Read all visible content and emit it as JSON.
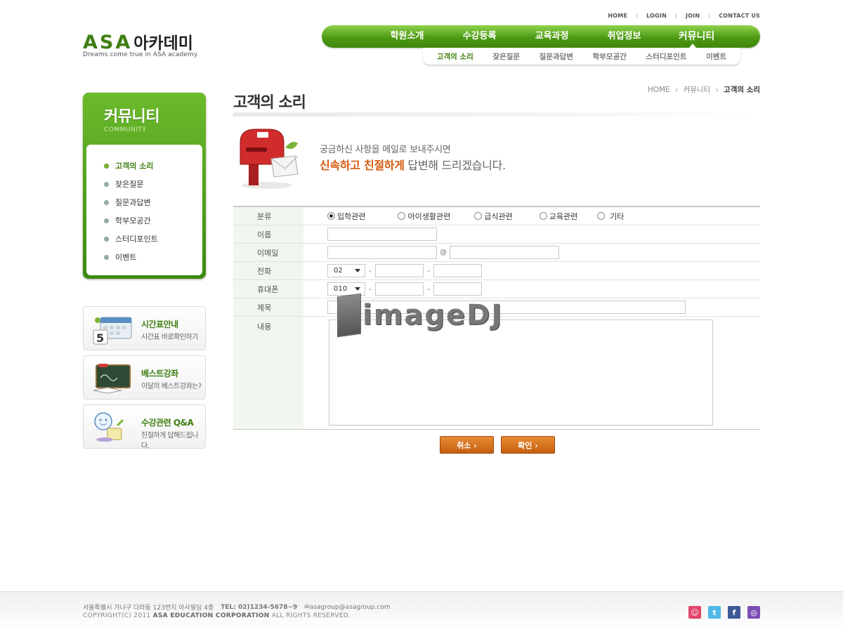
{
  "util_links": [
    "HOME",
    "LOGIN",
    "JOIN",
    "CONTACT US"
  ],
  "logo": {
    "brand": "ASA",
    "kr": "아카데미",
    "tagline": "Dreams come true in ASA academy"
  },
  "gnb": [
    "학원소개",
    "수강등록",
    "교육과정",
    "취업정보",
    "커뮤니티"
  ],
  "lnb": [
    "고객의 소리",
    "잦은질문",
    "질문과답변",
    "학부모공간",
    "스터디포인트",
    "이벤트"
  ],
  "leftmenu": {
    "title": "커뮤니티",
    "eng": "COMMUNITY",
    "items": [
      "고객의 소리",
      "잦은질문",
      "질문과답변",
      "학부모공간",
      "스터디포인트",
      "이벤트"
    ]
  },
  "banners": [
    {
      "title": "시간표안내",
      "desc": "시간표 바로확인하기"
    },
    {
      "title": "베스트강좌",
      "desc": "이달의 베스트강좌는?"
    },
    {
      "title": "수강관련 Q&A",
      "desc": "친절하게 답해드립니다."
    }
  ],
  "content": {
    "title": "고객의 소리",
    "breadcrumb": [
      "HOME",
      "커뮤니티",
      "고객의 소리"
    ],
    "intro_line1": "궁금하신 사항을 메일로 보내주시면",
    "intro_highlight": "신속하고 친절하게",
    "intro_rest": " 답변해 드리겠습니다."
  },
  "form": {
    "labels": {
      "category": "분류",
      "name": "이름",
      "email": "이메일",
      "phone": "전화",
      "mobile": "휴대폰",
      "subject": "제목",
      "body": "내용"
    },
    "categories": [
      "입학관련",
      "아이생활관련",
      "급식관련",
      "교육관련",
      "기타"
    ],
    "phone_prefix": "02",
    "mobile_prefix": "010",
    "email_at": "@",
    "dash": "-"
  },
  "watermark": "imageDJ",
  "buttons": {
    "cancel": "취소 ›",
    "confirm": "확인 ›"
  },
  "footer": {
    "address": "서울특별시 가나구 다라동 123번지 아사빌딩 4층",
    "tel": "TEL: 02)1234-5678~9",
    "email": "asagroup@asagroup.com",
    "copyright_prefix": "COPYRIGHT(C) 2011 ",
    "company": "ASA EDUCATION CORPORATION",
    "copyright_suffix": " ALL RIGHTS RESERVED."
  },
  "colors": {
    "brand_green": "#4d9a14",
    "accent_orange": "#d6580a"
  }
}
